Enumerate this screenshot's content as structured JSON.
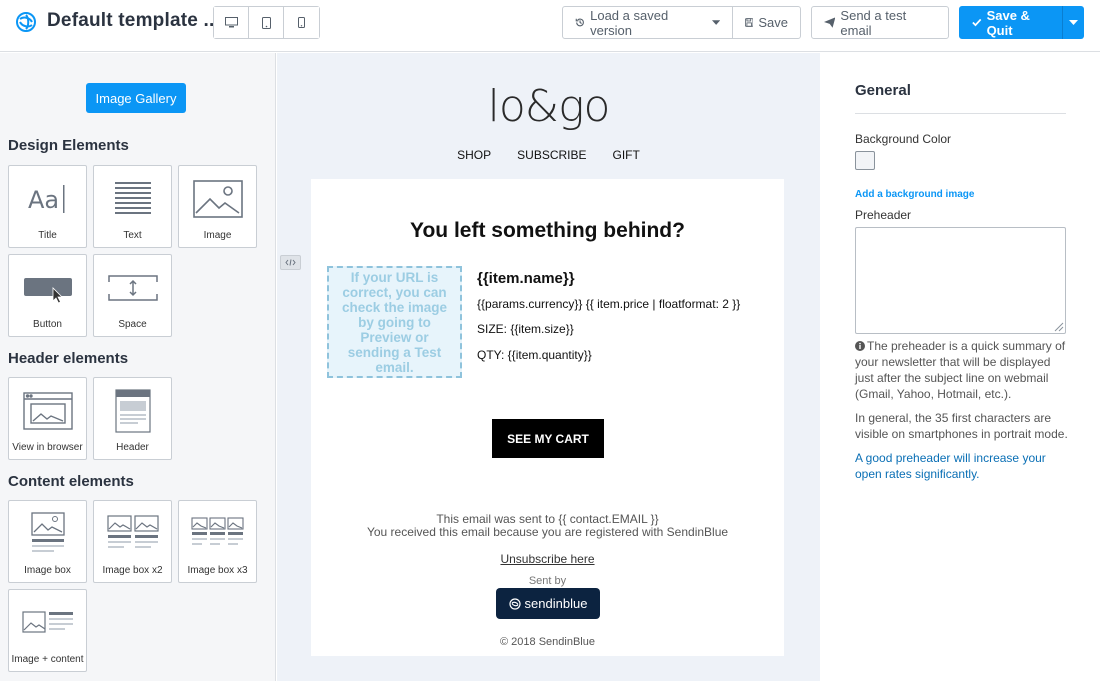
{
  "header": {
    "title": "Default template ...",
    "device_buttons": [
      "desktop",
      "tablet",
      "mobile"
    ],
    "load_version_label": "Load a saved version",
    "save_label": "Save",
    "send_test_label": "Send a test email",
    "save_quit_label": "Save & Quit"
  },
  "sidebar": {
    "gallery_label": "Image Gallery",
    "design_title": "Design Elements",
    "design_items": [
      "Title",
      "Text",
      "Image",
      "Button",
      "Space"
    ],
    "header_title": "Header elements",
    "header_items": [
      "View in browser",
      "Header"
    ],
    "content_title": "Content elements",
    "content_items": [
      "Image box",
      "Image box x2",
      "Image box x3",
      "Image + content"
    ]
  },
  "email": {
    "brand": "lo&go",
    "nav": [
      "SHOP",
      "SUBSCRIBE",
      "GIFT"
    ],
    "headline": "You left something behind?",
    "image_placeholder": "If your URL is correct, you can check the image by going to Preview or sending a Test email.",
    "item_name": "{{item.name}}",
    "item_price": "{{params.currency}} {{ item.price | floatformat: 2 }}",
    "item_size": "SIZE: {{item.size}}",
    "item_qty": "QTY: {{item.quantity}}",
    "cta": "SEE MY CART",
    "footer_line1": "This email was sent to {{ contact.EMAIL }}",
    "footer_line2": "You received this email because you are registered with SendinBlue",
    "unsubscribe": "Unsubscribe here",
    "sent_by": "Sent by",
    "badge": "sendinblue",
    "copyright": "© 2018 SendinBlue"
  },
  "panel": {
    "title": "General",
    "background_label": "Background Color",
    "background_color": "#f2f4f7",
    "add_bg_image": "Add a background image",
    "preheader_label": "Preheader",
    "help1": "The preheader is a quick summary of your newsletter that will be displayed just after the subject line on webmail (Gmail, Yahoo, Hotmail, etc.).",
    "help2": "In general, the 35 first characters are visible on smartphones in portrait mode.",
    "help3": "A good preheader will increase your open rates significantly."
  },
  "colors": {
    "accent": "#0b96f5",
    "badge": "#0c2340"
  }
}
